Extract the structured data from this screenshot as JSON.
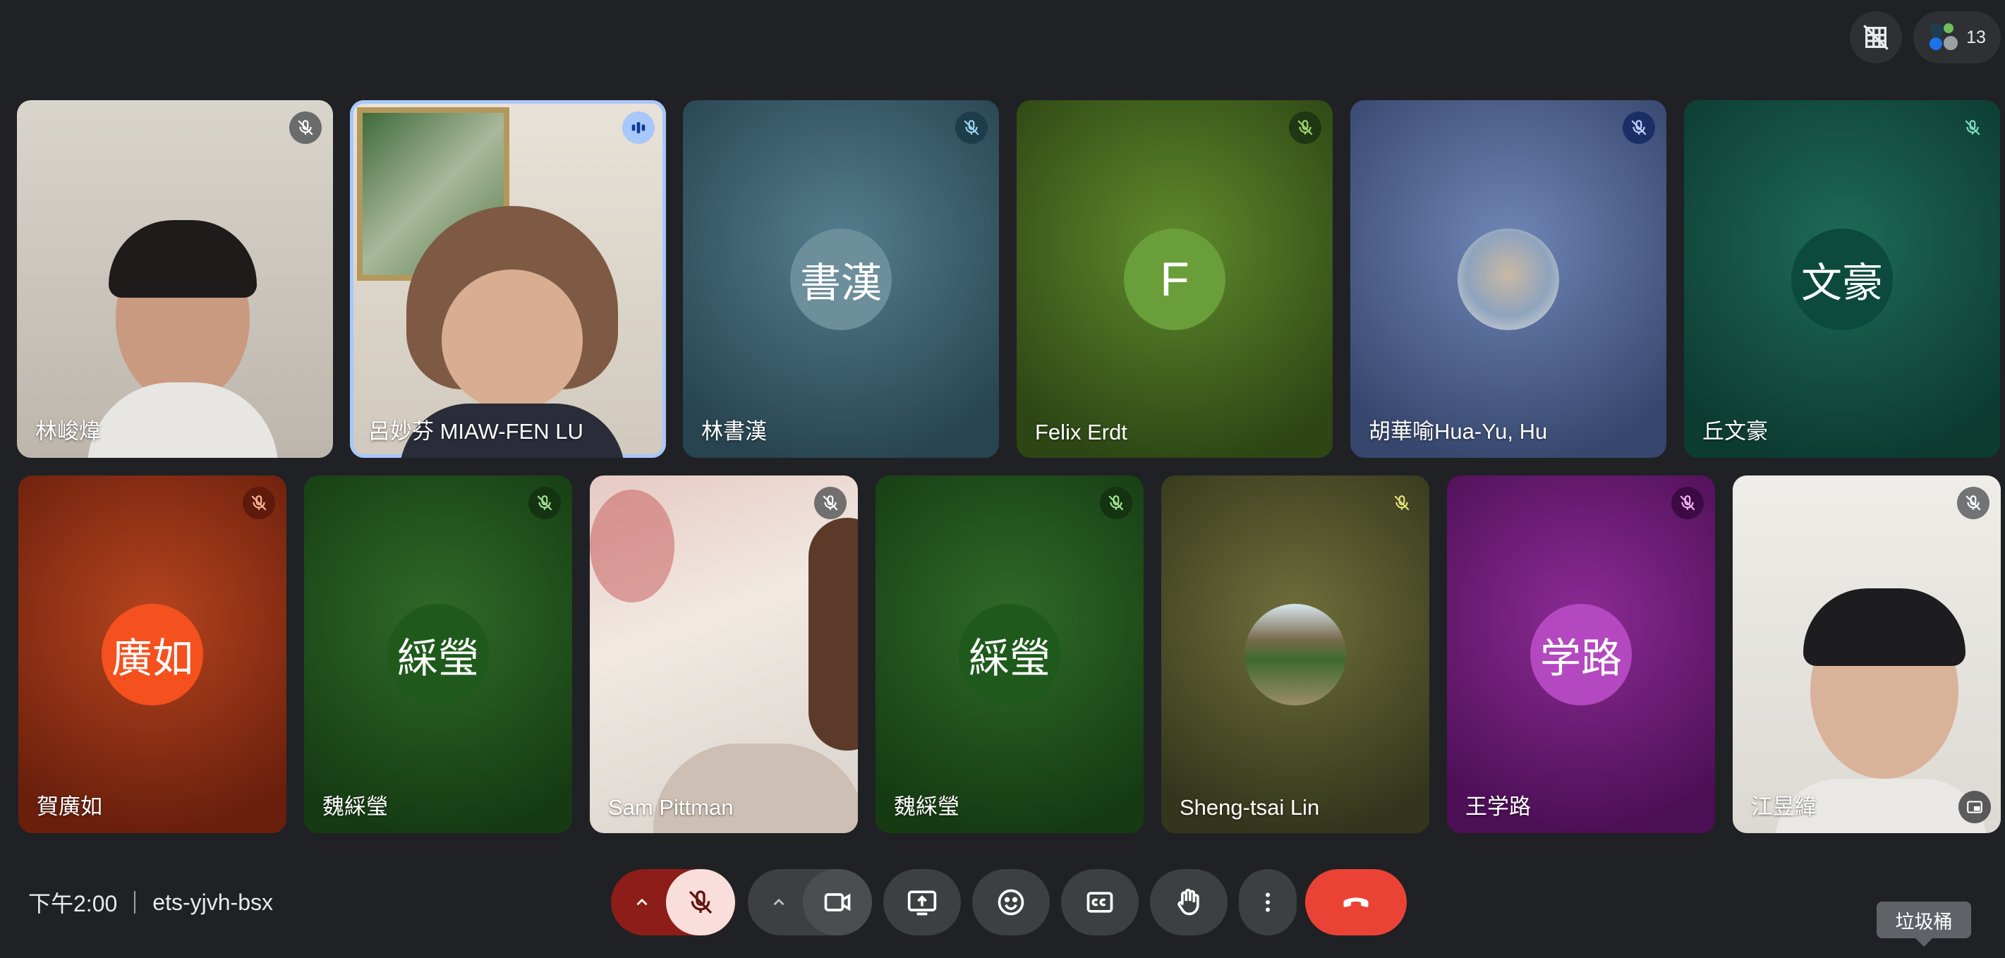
{
  "top": {
    "participant_count": "13"
  },
  "tiles": [
    {
      "name": "林峻煒"
    },
    {
      "name": "呂妙芬 MIAW-FEN LU"
    },
    {
      "name": "林書漢",
      "initials": "書漢"
    },
    {
      "name": "Felix Erdt",
      "initials": "F"
    },
    {
      "name": "胡華喻Hua-Yu, Hu"
    },
    {
      "name": "丘文豪",
      "initials": "文豪"
    },
    {
      "name": "賀廣如",
      "initials": "廣如"
    },
    {
      "name": "魏綵瑩",
      "initials": "綵瑩"
    },
    {
      "name": "Sam Pittman"
    },
    {
      "name": "魏綵瑩",
      "initials": "綵瑩"
    },
    {
      "name": "Sheng-tsai Lin"
    },
    {
      "name": "王学路",
      "initials": "学路"
    },
    {
      "name": "江昱緯"
    }
  ],
  "bottom": {
    "time": "下午2:00",
    "meeting_code": "ets-yjvh-bsx",
    "tooltip": "垃圾桶"
  },
  "colors": {
    "end_call": "#ea4335",
    "mic_off_bg": "#f9dedc",
    "mic_group": "#8c1d18"
  }
}
